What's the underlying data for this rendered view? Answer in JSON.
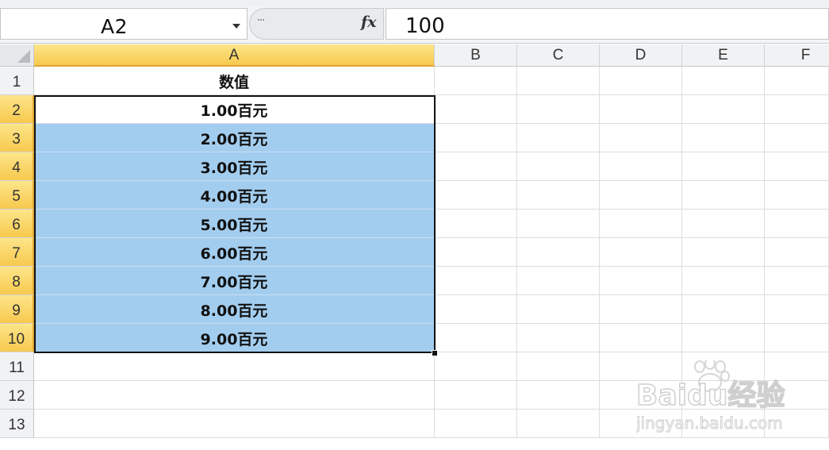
{
  "formula_bar": {
    "name_box": "A2",
    "fx_label": "fx",
    "formula_value": "100"
  },
  "columns": [
    "A",
    "B",
    "C",
    "D",
    "E",
    "F"
  ],
  "rows": [
    "1",
    "2",
    "3",
    "4",
    "5",
    "6",
    "7",
    "8",
    "9",
    "10",
    "11",
    "12",
    "13"
  ],
  "column_a": [
    "数值",
    "1.00百元",
    "2.00百元",
    "3.00百元",
    "4.00百元",
    "5.00百元",
    "6.00百元",
    "7.00百元",
    "8.00百元",
    "9.00百元",
    "",
    "",
    ""
  ],
  "selection": {
    "active_cell": "A2",
    "range": "A2:A10"
  },
  "colors": {
    "selection_fill": "#a3cdef",
    "active_header": "#f7c94e",
    "grid_line": "#dcdde0"
  },
  "watermark": {
    "brand": "Baidu经验",
    "url": "jingyan.baidu.com"
  }
}
